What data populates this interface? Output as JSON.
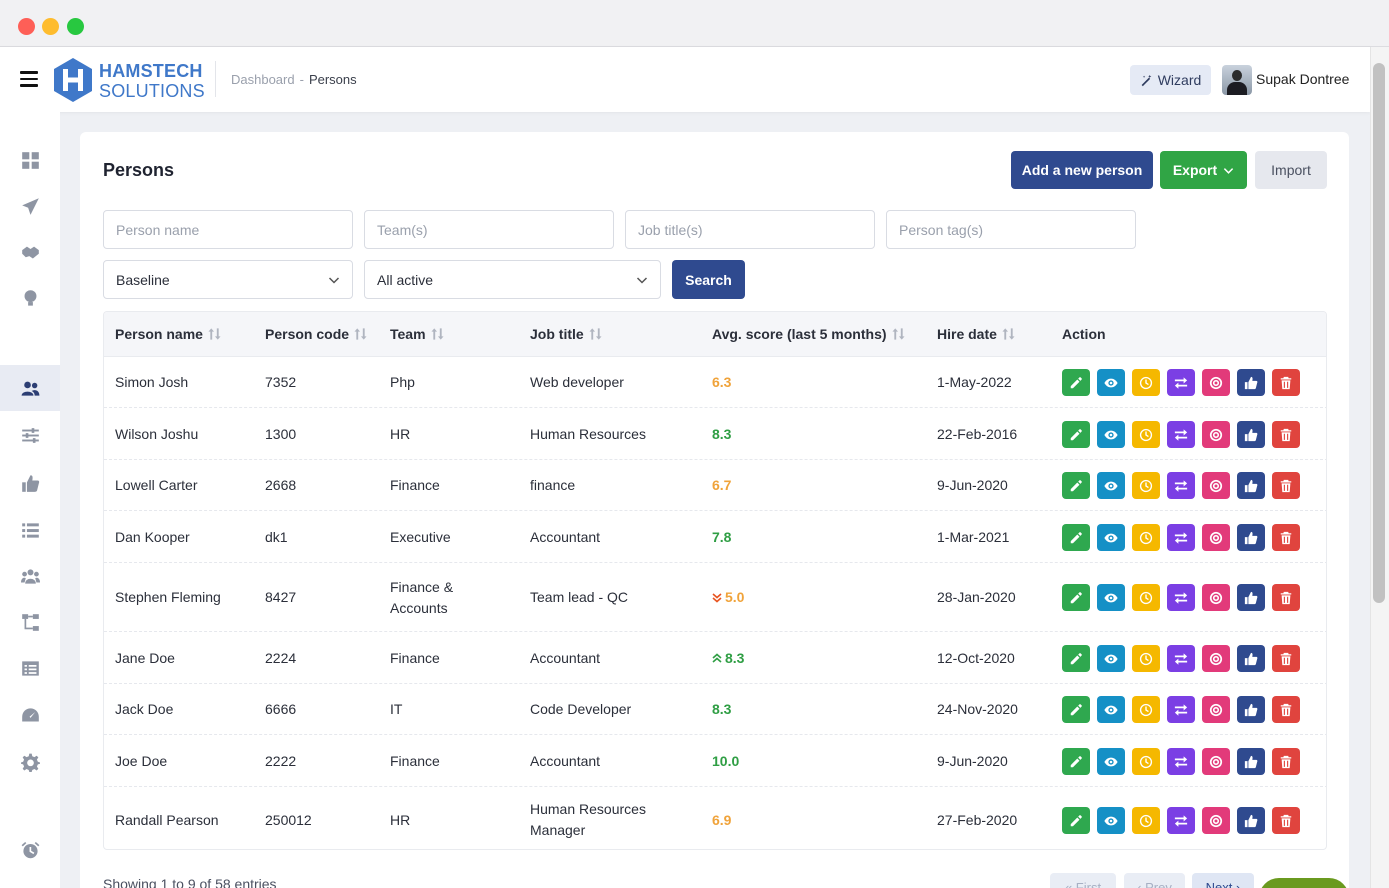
{
  "app": {
    "logo_line1": "HAMSTECH",
    "logo_line2": "SOLUTIONS",
    "breadcrumb": {
      "parent": "Dashboard",
      "separator": "-",
      "current": "Persons"
    },
    "wizard_label": "Wizard",
    "user_name": "Supak Dontree"
  },
  "page": {
    "title": "Persons",
    "add_button": "Add a new person",
    "export_button": "Export",
    "import_button": "Import"
  },
  "filters": {
    "person_name_placeholder": "Person name",
    "teams_placeholder": "Team(s)",
    "job_titles_placeholder": "Job title(s)",
    "person_tags_placeholder": "Person tag(s)",
    "baseline_value": "Baseline",
    "status_value": "All active",
    "search_button": "Search"
  },
  "table": {
    "headers": {
      "person_name": "Person name",
      "person_code": "Person code",
      "team": "Team",
      "job_title": "Job title",
      "avg_score": "Avg. score (last 5 months)",
      "hire_date": "Hire date",
      "action": "Action"
    },
    "rows": [
      {
        "name": "Simon Josh",
        "code": "7352",
        "team": "Php",
        "job": "Web developer",
        "score": "6.3",
        "score_color": "#f0a33a",
        "trend": "",
        "hire": "1-May-2022"
      },
      {
        "name": "Wilson Joshu",
        "code": "1300",
        "team": "HR",
        "job": "Human Resources",
        "score": "8.3",
        "score_color": "#2f9e44",
        "trend": "",
        "hire": "22-Feb-2016"
      },
      {
        "name": "Lowell Carter",
        "code": "2668",
        "team": "Finance",
        "job": "finance",
        "score": "6.7",
        "score_color": "#f0a33a",
        "trend": "",
        "hire": "9-Jun-2020"
      },
      {
        "name": "Dan Kooper",
        "code": "dk1",
        "team": "Executive",
        "job": "Accountant",
        "score": "7.8",
        "score_color": "#2f9e44",
        "trend": "",
        "hire": "1-Mar-2021"
      },
      {
        "name": "Stephen Fleming",
        "code": "8427",
        "team": "Finance & Accounts",
        "job": "Team lead - QC",
        "score": "5.0",
        "score_color": "#f0a33a",
        "trend": "down",
        "hire": "28-Jan-2020"
      },
      {
        "name": "Jane Doe",
        "code": "2224",
        "team": "Finance",
        "job": "Accountant",
        "score": "8.3",
        "score_color": "#2f9e44",
        "trend": "up",
        "hire": "12-Oct-2020"
      },
      {
        "name": "Jack Doe",
        "code": "6666",
        "team": "IT",
        "job": "Code Developer",
        "score": "8.3",
        "score_color": "#2f9e44",
        "trend": "",
        "hire": "24-Nov-2020"
      },
      {
        "name": "Joe Doe",
        "code": "2222",
        "team": "Finance",
        "job": "Accountant",
        "score": "10.0",
        "score_color": "#2f9e44",
        "trend": "",
        "hire": "9-Jun-2020"
      },
      {
        "name": "Randall Pearson",
        "code": "250012",
        "team": "HR",
        "job": "Human Resources Manager",
        "score": "6.9",
        "score_color": "#f0a33a",
        "trend": "",
        "hire": "27-Feb-2020"
      }
    ],
    "action_buttons": [
      {
        "name": "edit",
        "icon": "pencil-icon",
        "color": "#2fa84f"
      },
      {
        "name": "view",
        "icon": "eye-icon",
        "color": "#1590c6"
      },
      {
        "name": "history",
        "icon": "clock-icon",
        "color": "#f5b800"
      },
      {
        "name": "transfer",
        "icon": "arrows-swap-icon",
        "color": "#7b3fe4"
      },
      {
        "name": "goal",
        "icon": "target-icon",
        "color": "#e23a7a"
      },
      {
        "name": "feedback",
        "icon": "thumbs-up-icon",
        "color": "#2f4a8f"
      },
      {
        "name": "delete",
        "icon": "trash-icon",
        "color": "#e0443e"
      }
    ],
    "trend_colors": {
      "down": "#e8531f",
      "up": "#2f9e44"
    }
  },
  "footer": {
    "showing": "Showing 1 to 9 of 58 entries",
    "first": "« First",
    "prev": "‹ Prev",
    "next": "Next ›"
  },
  "sidebar": {
    "items": [
      "grid-icon",
      "paper-plane-icon",
      "handshake-icon",
      "lightbulb-icon",
      "users-icon",
      "sliders-icon",
      "thumbs-up-icon",
      "list-icon",
      "team-icon",
      "sitemap-icon",
      "report-icon",
      "gauge-icon",
      "gear-icon",
      "alarm-clock-icon"
    ],
    "active": "users-icon"
  }
}
